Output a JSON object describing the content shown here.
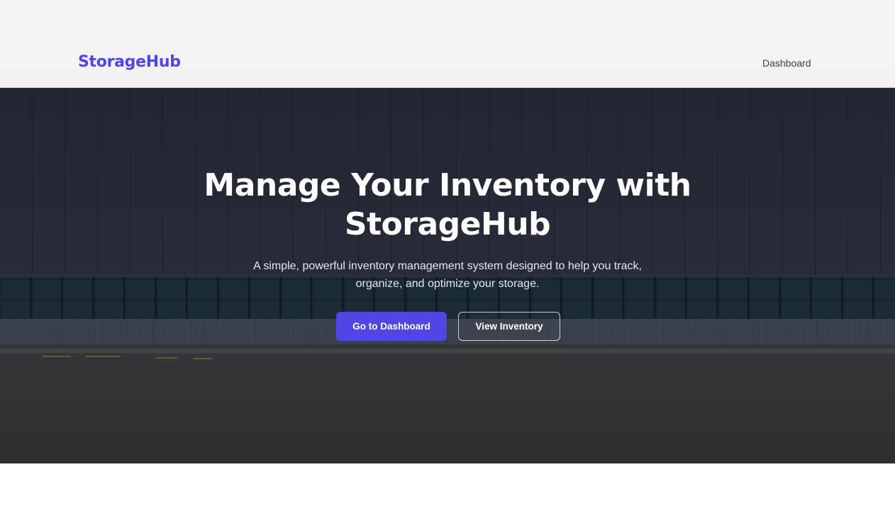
{
  "header": {
    "logo": "StorageHub",
    "nav": {
      "dashboard_label": "Dashboard"
    }
  },
  "hero": {
    "title": "Manage Your Inventory with StorageHub",
    "subtitle": "A simple, powerful inventory management system designed to help you track, organize, and optimize your storage.",
    "primary_button": "Go to Dashboard",
    "secondary_button": "View Inventory"
  },
  "colors": {
    "brand": "#4f46e5",
    "header_bg": "#f4f4f5",
    "hero_text": "#ffffff"
  }
}
